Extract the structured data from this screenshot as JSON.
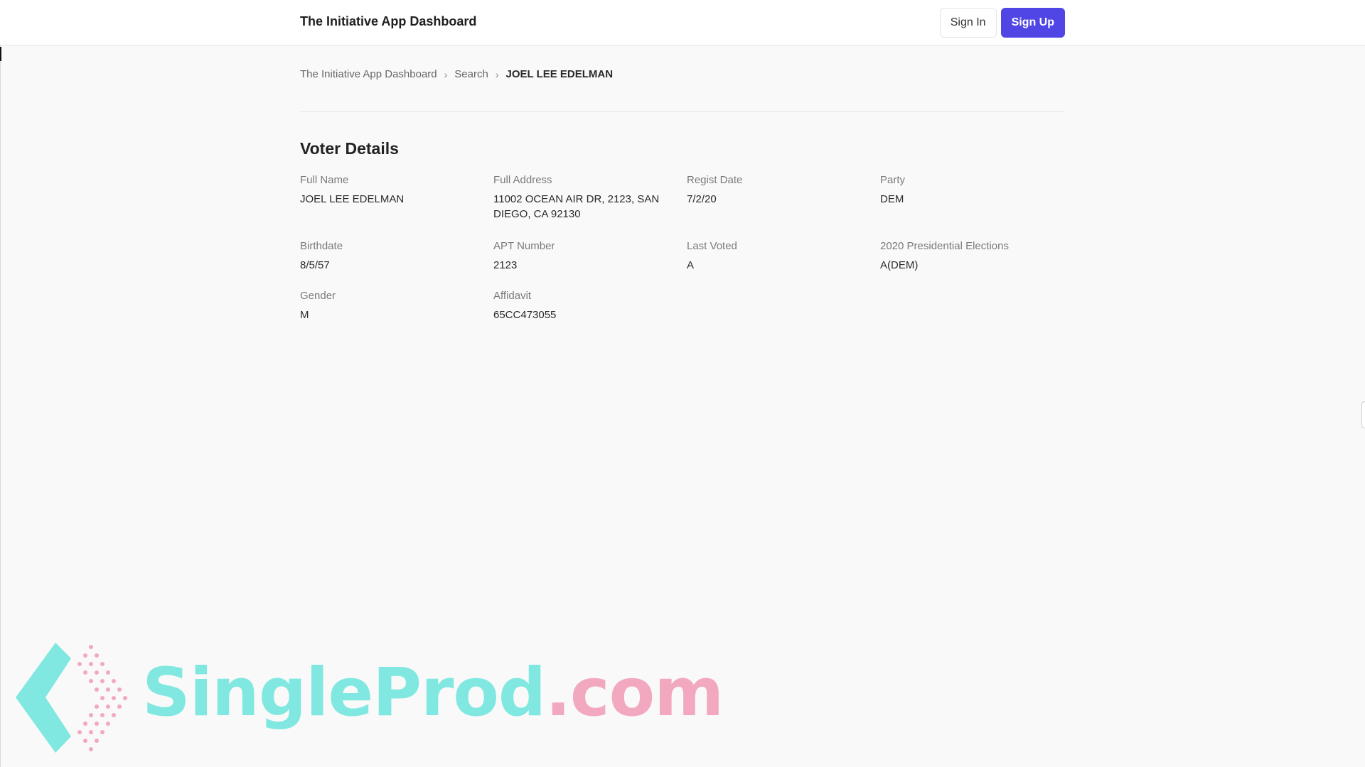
{
  "header": {
    "brand": "The Initiative App Dashboard",
    "sign_in": "Sign In",
    "sign_up": "Sign Up"
  },
  "breadcrumb": {
    "items": [
      "The Initiative App Dashboard",
      "Search",
      "JOEL LEE EDELMAN"
    ],
    "separator": "›"
  },
  "voter": {
    "title": "Voter Details",
    "fields": {
      "full_name": {
        "label": "Full Name",
        "value": "JOEL LEE EDELMAN"
      },
      "full_address": {
        "label": "Full Address",
        "value": "11002 OCEAN AIR DR, 2123, SAN DIEGO, CA 92130"
      },
      "regist_date": {
        "label": "Regist Date",
        "value": "7/2/20"
      },
      "party": {
        "label": "Party",
        "value": "DEM"
      },
      "birthdate": {
        "label": "Birthdate",
        "value": "8/5/57"
      },
      "apt_number": {
        "label": "APT Number",
        "value": "2123"
      },
      "last_voted": {
        "label": "Last Voted",
        "value": "A"
      },
      "presidential_2020": {
        "label": "2020 Presidential Elections",
        "value": "A(DEM)"
      },
      "gender": {
        "label": "Gender",
        "value": "M"
      },
      "affidavit": {
        "label": "Affidavit",
        "value": "65CC473055"
      }
    }
  },
  "watermark": {
    "text_a": "SingleProd",
    "text_b": ".com"
  },
  "colors": {
    "accent": "#5046e5",
    "watermark_teal": "#80e8e0",
    "watermark_pink": "#f2a8bf"
  }
}
